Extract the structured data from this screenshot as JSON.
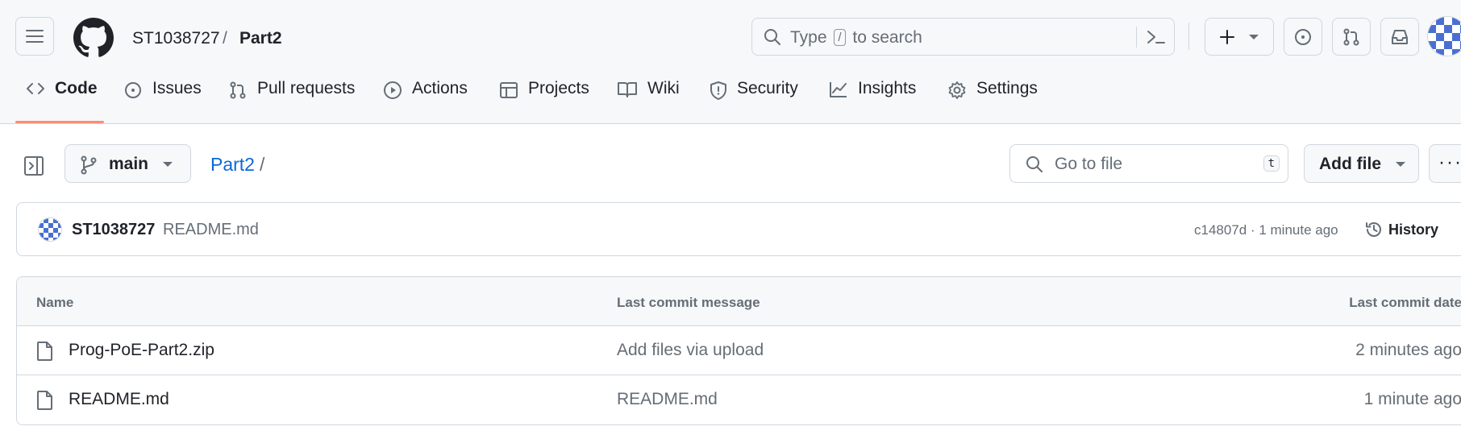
{
  "header": {
    "owner": "ST1038727",
    "separator": "/",
    "repo": "Part2",
    "search": {
      "prefix": "Type",
      "key": "/",
      "suffix": "to search"
    }
  },
  "tabs": [
    {
      "label": "Code",
      "icon": "code-icon",
      "active": true
    },
    {
      "label": "Issues",
      "icon": "issue-opened-icon"
    },
    {
      "label": "Pull requests",
      "icon": "git-pull-request-icon"
    },
    {
      "label": "Actions",
      "icon": "play-icon"
    },
    {
      "label": "Projects",
      "icon": "table-icon"
    },
    {
      "label": "Wiki",
      "icon": "book-icon"
    },
    {
      "label": "Security",
      "icon": "shield-icon"
    },
    {
      "label": "Insights",
      "icon": "graph-icon"
    },
    {
      "label": "Settings",
      "icon": "gear-icon"
    }
  ],
  "toolbar": {
    "branch": "main",
    "path_repo": "Part2",
    "path_sep": "/",
    "goto_placeholder": "Go to file",
    "goto_key": "t",
    "add_file": "Add file",
    "more": "···"
  },
  "commit": {
    "author": "ST1038727",
    "message": "README.md",
    "hash_time": "c14807d · 1 minute ago",
    "history": "History"
  },
  "table": {
    "columns": [
      "Name",
      "Last commit message",
      "Last commit date"
    ],
    "rows": [
      {
        "name": "Prog-PoE-Part2.zip",
        "message": "Add files via upload",
        "date": "2 minutes ago"
      },
      {
        "name": "README.md",
        "message": "README.md",
        "date": "1 minute ago"
      }
    ]
  },
  "colors": {
    "accent_underline": "#fd8c73",
    "link": "#0969da",
    "avatar": "#4a6fd0"
  }
}
